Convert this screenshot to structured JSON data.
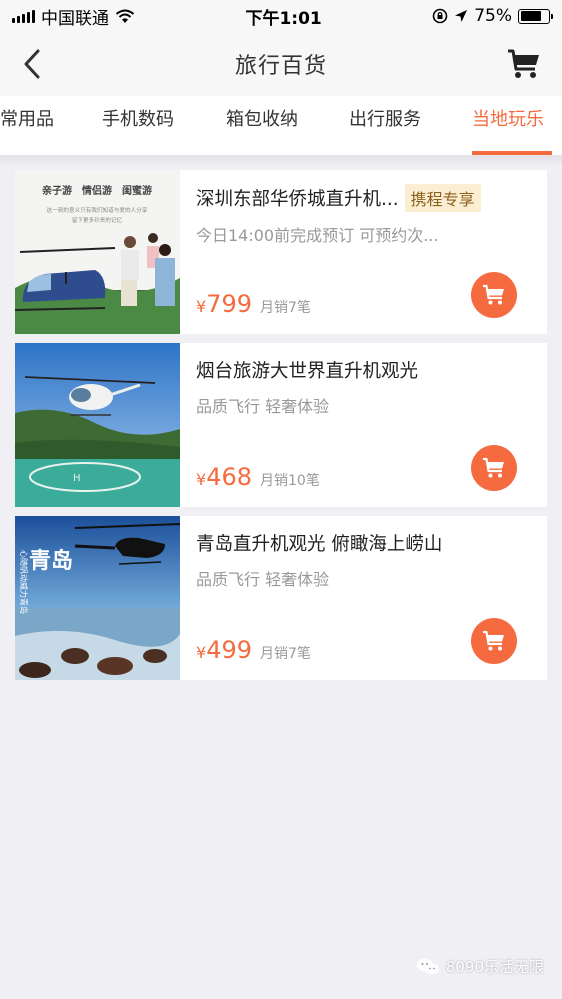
{
  "status_bar": {
    "carrier": "中国联通",
    "time": "下午1:01",
    "battery": "75%",
    "battery_level": 0.75
  },
  "nav": {
    "title": "旅行百货",
    "back_icon": "chevron-left-icon",
    "cart_icon": "cart-icon"
  },
  "tabs": [
    {
      "label": "常用品"
    },
    {
      "label": "手机数码"
    },
    {
      "label": "箱包收纳"
    },
    {
      "label": "出行服务"
    },
    {
      "label": "当地玩乐",
      "active": true
    }
  ],
  "products": [
    {
      "title": "深圳东部华侨城直升机...",
      "badge": "携程专享",
      "subtitle": "今日14:00前完成预订 可预约次...",
      "currency": "¥",
      "price": "799",
      "sales": "月销7笔",
      "image": {
        "tags": "亲子游　情侣游　闺蜜游",
        "caption_line1": "这一刻的意义只有我们知道与爱的人分享",
        "caption_line2": "留下更多珍贵的记忆"
      }
    },
    {
      "title": "烟台旅游大世界直升机观光",
      "subtitle": "品质飞行 轻奢体验",
      "currency": "¥",
      "price": "468",
      "sales": "月销10笔"
    },
    {
      "title": "青岛直升机观光 俯瞰海上崂山",
      "subtitle": "品质飞行 轻奢体验",
      "currency": "¥",
      "price": "499",
      "sales": "月销7笔",
      "image": {
        "big_text": "青岛",
        "side_text": "心随帆动威力青岛"
      }
    }
  ],
  "watermark": {
    "icon": "wechat-icon",
    "text": "8090乐活无限"
  },
  "colors": {
    "accent": "#f56b3f",
    "badge_bg": "#fbeed2",
    "badge_text": "#8c5f1b",
    "page_bg": "#efeff4"
  }
}
